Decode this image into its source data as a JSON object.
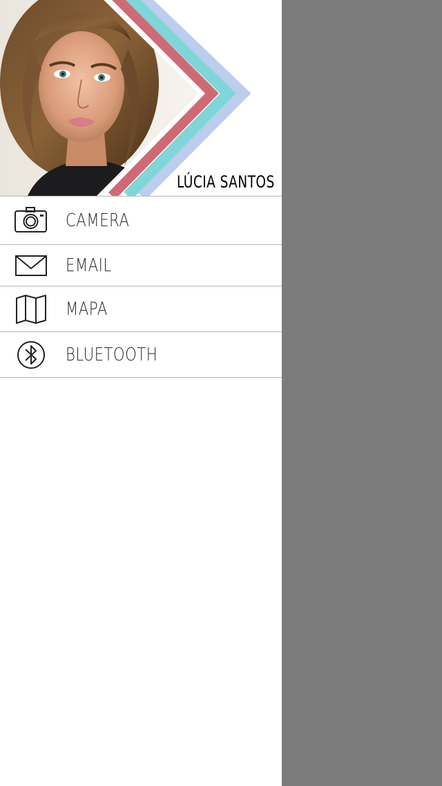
{
  "profile": {
    "name": "LÚCIA SANTOS",
    "photo_icon": "profile-photo",
    "accent_colors": [
      "#5ed3c7",
      "#cf6a75",
      "#7fd6d8",
      "#bccdee"
    ]
  },
  "menu": {
    "items": [
      {
        "label": "CAMERA",
        "icon": "camera-icon"
      },
      {
        "label": "EMAIL",
        "icon": "envelope-icon"
      },
      {
        "label": "MAPA",
        "icon": "map-icon"
      },
      {
        "label": "BLUETOOTH",
        "icon": "bluetooth-icon"
      }
    ]
  },
  "colors": {
    "drawer_bg": "#ffffff",
    "overlay_bg": "#7b7b7b",
    "divider": "#b5b5b5",
    "text": "#2a2a2a"
  }
}
